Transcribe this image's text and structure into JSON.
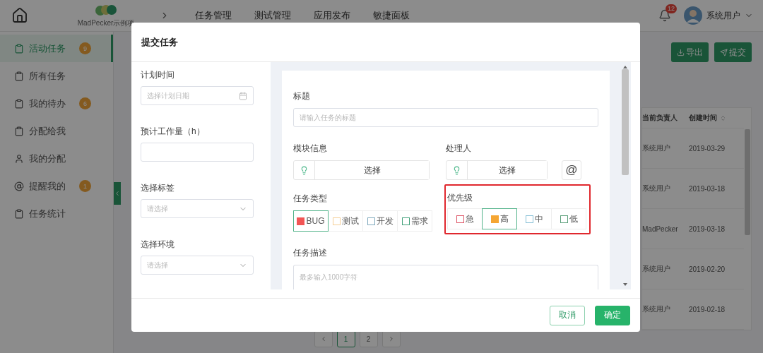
{
  "header": {
    "logo_text": "MadPecker示例项",
    "nav": [
      "任务管理",
      "测试管理",
      "应用发布",
      "敏捷面板"
    ],
    "notification_count": "12",
    "user_name": "系统用户"
  },
  "sidebar": {
    "items": [
      {
        "label": "活动任务",
        "kind": "clipboard",
        "badge": "9",
        "selected": true
      },
      {
        "label": "所有任务",
        "kind": "clipboard",
        "selected": false
      },
      {
        "label": "我的待办",
        "kind": "clipboard",
        "badge": "6",
        "selected": false
      },
      {
        "label": "分配给我",
        "kind": "clipboard",
        "selected": false
      },
      {
        "label": "我的分配",
        "kind": "user",
        "selected": false
      },
      {
        "label": "提醒我的",
        "kind": "at",
        "badge": "1",
        "selected": false
      },
      {
        "label": "任务统计",
        "kind": "clipboard",
        "selected": false
      }
    ]
  },
  "toolbar": {
    "buttons": [
      {
        "label": "导出",
        "kind": "export"
      },
      {
        "label": "提交",
        "kind": "submit"
      }
    ]
  },
  "table": {
    "columns": [
      {
        "label": "当前负责人",
        "sortable": false
      },
      {
        "label": "创建时间",
        "sortable": true
      }
    ],
    "rows": [
      [
        "系统用户",
        "2019-03-29"
      ],
      [
        "系统用户",
        "2019-03-18"
      ],
      [
        "MadPecker",
        "2019-03-18"
      ],
      [
        "系统用户",
        "2019-02-20"
      ],
      [
        "系统用户",
        "2019-02-18"
      ]
    ]
  },
  "pagination": {
    "pages": [
      {
        "label": "1",
        "selected": true
      },
      {
        "label": "2",
        "selected": false
      }
    ]
  },
  "dialog": {
    "title": "提交任务",
    "left_fields": [
      {
        "label": "计划时间",
        "kind": "date",
        "placeholder": "选择计划日期"
      },
      {
        "label": "预计工作量（h）",
        "kind": "text"
      },
      {
        "label": "选择标签",
        "kind": "select",
        "placeholder": "请选择"
      },
      {
        "label": "选择环境",
        "kind": "select",
        "placeholder": "请选择"
      }
    ],
    "form": {
      "title_field": {
        "label": "标题",
        "placeholder": "请输入任务的标题"
      },
      "module": {
        "label": "模块信息",
        "button": "选择"
      },
      "assignee": {
        "label": "处理人",
        "button": "选择",
        "mention": "@"
      },
      "task_type": {
        "label": "任务类型",
        "options": [
          {
            "label": "BUG",
            "color": "#f25555",
            "selected": true
          },
          {
            "label": "测试",
            "color": "#f5cf96",
            "selected": false
          },
          {
            "label": "开发",
            "color": "#7fa9bd",
            "selected": false
          },
          {
            "label": "需求",
            "color": "#3f9f78",
            "selected": false
          }
        ]
      },
      "priority": {
        "label": "优先级",
        "highlighted": true,
        "options": [
          {
            "label": "急",
            "color": "#dd5566",
            "selected": false
          },
          {
            "label": "高",
            "color": "#f5a633",
            "selected": true
          },
          {
            "label": "中",
            "color": "#86bfd6",
            "selected": false
          },
          {
            "label": "低",
            "color": "#5a9f7a",
            "selected": false
          }
        ]
      },
      "description": {
        "label": "任务描述",
        "placeholder": "最多输入1000字符"
      }
    },
    "buttons": [
      {
        "label": "取消",
        "kind": "secondary"
      },
      {
        "label": "确定",
        "kind": "primary"
      }
    ]
  }
}
